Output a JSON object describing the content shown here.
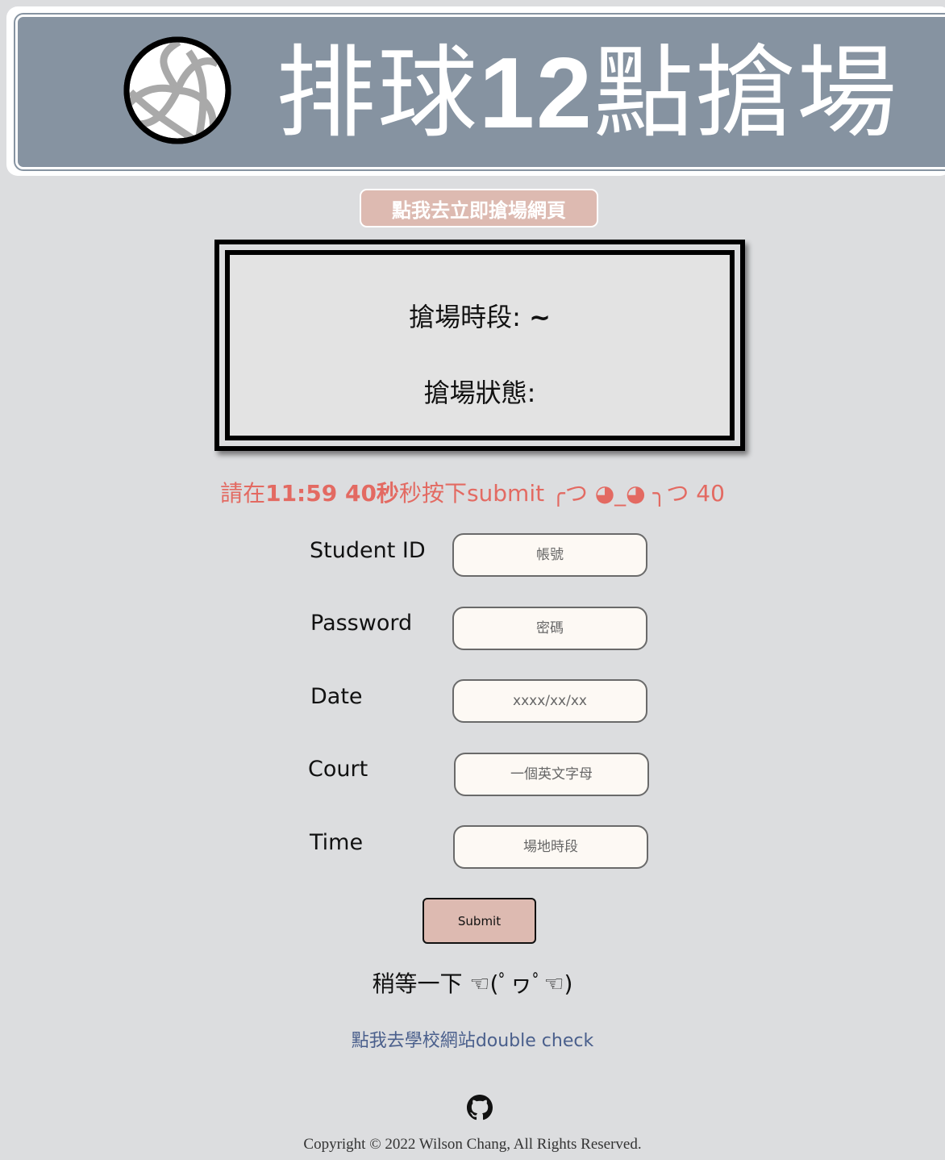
{
  "header": {
    "title_prefix": "排球",
    "title_number": "12",
    "title_suffix": "點搶場",
    "logo_icon": "volleyball-icon"
  },
  "reserve_button": {
    "label": "點我去立即搶場網頁"
  },
  "info": {
    "slot_label": "搶場時段:",
    "slot_value": "~",
    "status_label": "搶場狀態:",
    "status_value": ""
  },
  "instruction": {
    "prefix": "請在",
    "time": "11:59 40秒",
    "middle": "秒按下",
    "action": "submit",
    "face": " ╭つ ◕_◕ ╮つ 40"
  },
  "form": {
    "student_id": {
      "label": "Student ID",
      "placeholder": "帳號"
    },
    "password": {
      "label": "Password",
      "placeholder": "密碼"
    },
    "date": {
      "label": "Date",
      "placeholder": "xxxx/xx/xx"
    },
    "court": {
      "label": "Court",
      "placeholder": "一個英文字母"
    },
    "time": {
      "label": "Time",
      "placeholder": "場地時段"
    },
    "submit_label": "Submit"
  },
  "wait_text": "稍等一下 ☜(ﾟヮﾟ☜)",
  "double_check": {
    "prefix": "點我去學校網站",
    "suffix": "double check"
  },
  "footer": {
    "github_icon": "github-icon",
    "copyright": "Copyright © 2022 Wilson Chang, All Rights Reserved."
  },
  "colors": {
    "background": "#dcdddf",
    "header_bg": "#8693a1",
    "accent_pink": "#ddbab1",
    "instruction_red": "#e36a62",
    "link_blue": "#4a5f8c",
    "input_bg": "#fdf9f4"
  }
}
